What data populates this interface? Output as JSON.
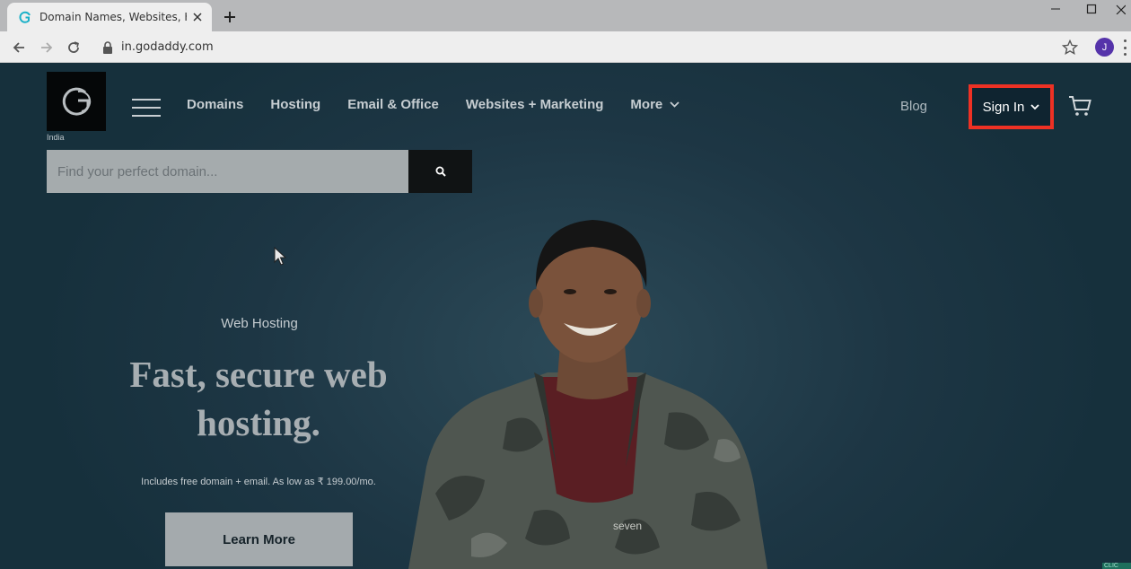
{
  "browser": {
    "tab": {
      "title": "Domain Names, Websites, Hosting",
      "favicon": "godaddy-favicon",
      "close_icon": "close-icon"
    },
    "new_tab_icon": "plus-icon",
    "window_controls": [
      "minimize-icon",
      "maximize-icon",
      "close-icon"
    ],
    "url": "in.godaddy.com",
    "profile_initial": "J",
    "colors": {
      "tab_strip": "#b7b8ba",
      "toolbar": "#eeeeee",
      "profile": "#5533aa"
    }
  },
  "header": {
    "country": "India",
    "nav": [
      {
        "label": "Domains"
      },
      {
        "label": "Hosting"
      },
      {
        "label": "Email & Office"
      },
      {
        "label": "Websites + Marketing"
      },
      {
        "label": "More",
        "has_dropdown": true
      }
    ],
    "blog_label": "Blog",
    "signin_label": "Sign In",
    "colors": {
      "signin_highlight": "#ee3124"
    }
  },
  "search": {
    "placeholder": "Find your perfect domain...",
    "value": "",
    "button_icon": "search-icon"
  },
  "hero": {
    "eyebrow": "Web Hosting",
    "headline": "Fast, secure web hosting.",
    "subline": "Includes free domain + email. As low as ₹ 199.00/mo.",
    "cta_label": "Learn More",
    "shirt_text": "seven"
  },
  "corner_badge": "CLIC"
}
